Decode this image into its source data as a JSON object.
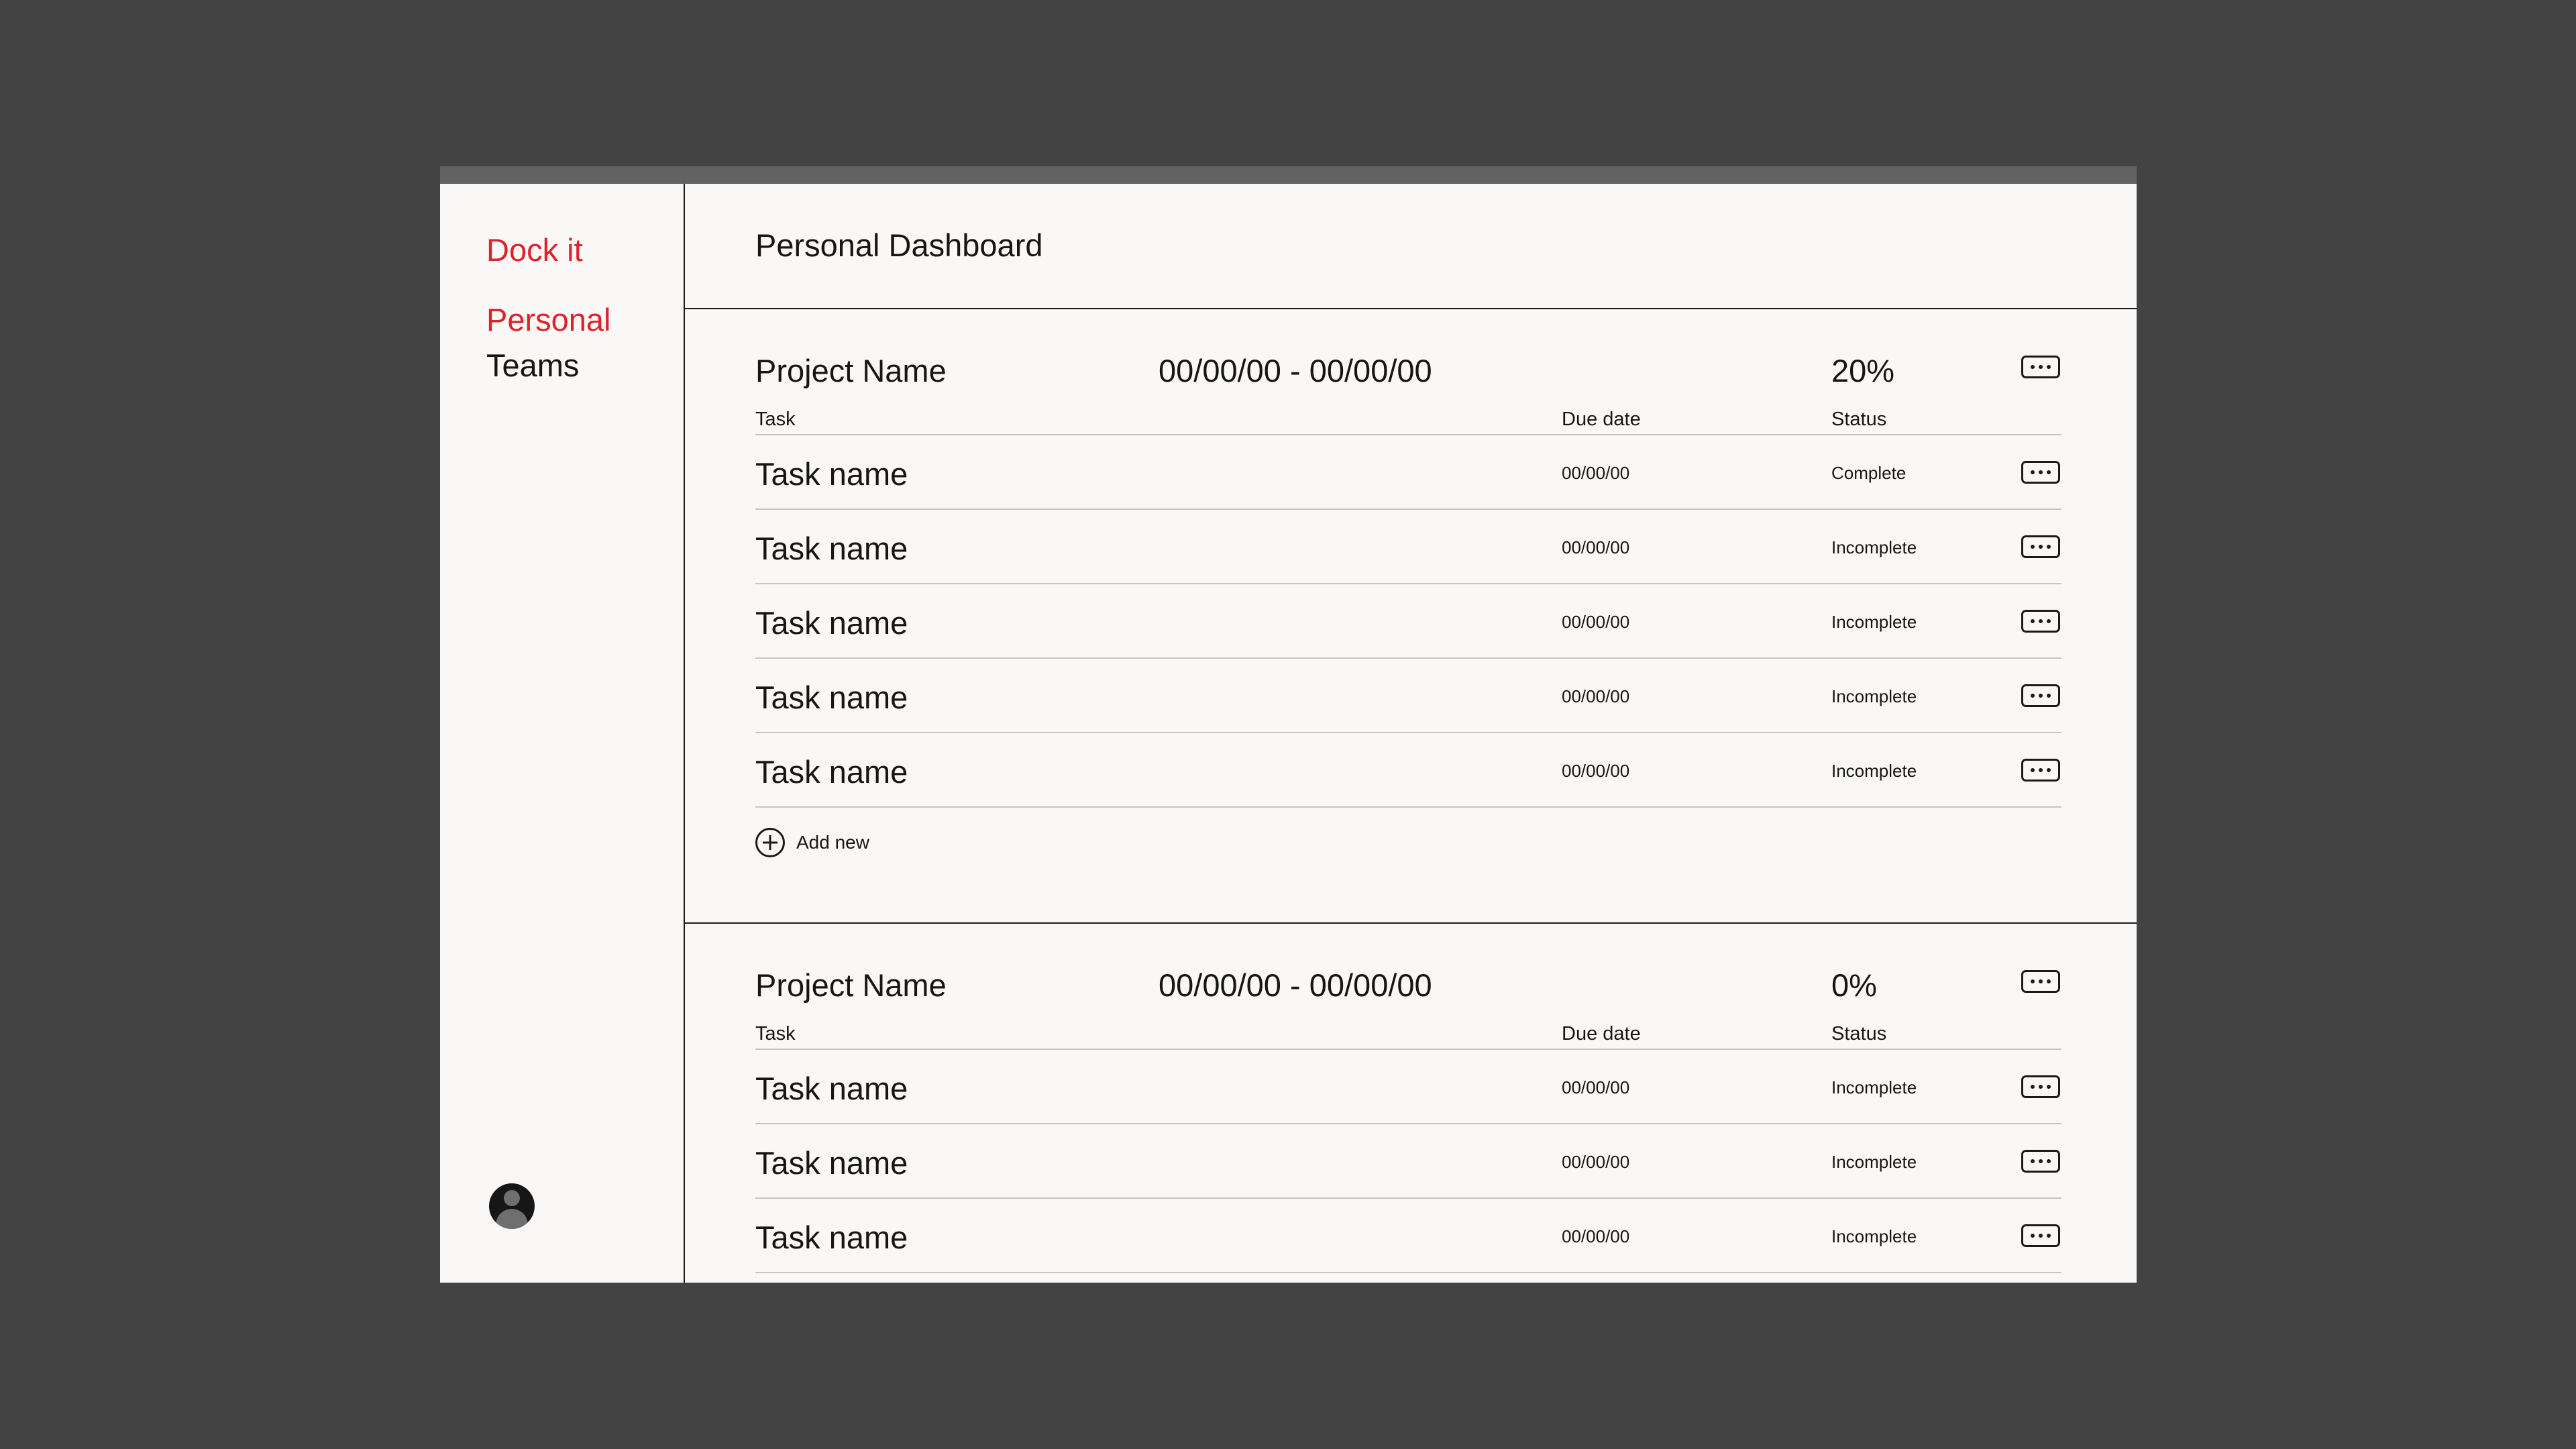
{
  "app": {
    "brand": "Dock it",
    "nav": [
      {
        "label": "Personal",
        "active": true
      },
      {
        "label": "Teams",
        "active": false
      }
    ],
    "accent_color": "#e0202b"
  },
  "page": {
    "title": "Personal Dashboard"
  },
  "columns": {
    "task": "Task",
    "due": "Due date",
    "status": "Status"
  },
  "projects": [
    {
      "name": "Project Name",
      "dates": "00/00/00 - 00/00/00",
      "progress": "20%",
      "add_new_label": "Add new",
      "tasks": [
        {
          "name": "Task name",
          "due": "00/00/00",
          "status": "Complete"
        },
        {
          "name": "Task name",
          "due": "00/00/00",
          "status": "Incomplete"
        },
        {
          "name": "Task name",
          "due": "00/00/00",
          "status": "Incomplete"
        },
        {
          "name": "Task name",
          "due": "00/00/00",
          "status": "Incomplete"
        },
        {
          "name": "Task name",
          "due": "00/00/00",
          "status": "Incomplete"
        }
      ]
    },
    {
      "name": "Project Name",
      "dates": "00/00/00 - 00/00/00",
      "progress": "0%",
      "tasks": [
        {
          "name": "Task name",
          "due": "00/00/00",
          "status": "Incomplete"
        },
        {
          "name": "Task name",
          "due": "00/00/00",
          "status": "Incomplete"
        },
        {
          "name": "Task name",
          "due": "00/00/00",
          "status": "Incomplete"
        }
      ]
    }
  ],
  "icons": {
    "more": "more-horizontal-icon",
    "add": "plus-circle-icon",
    "avatar": "user-avatar-icon"
  }
}
